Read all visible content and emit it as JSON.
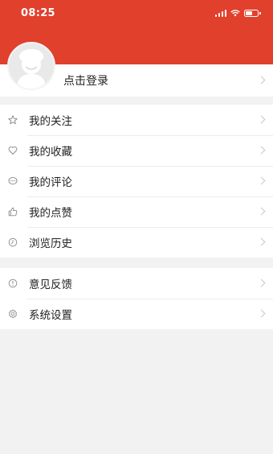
{
  "status_bar": {
    "time": "08:25",
    "battery_level": 0.55
  },
  "profile": {
    "login_label": "点击登录"
  },
  "menu_group_1": [
    {
      "icon": "star-icon",
      "label": "我的关注"
    },
    {
      "icon": "heart-icon",
      "label": "我的收藏"
    },
    {
      "icon": "comment-icon",
      "label": "我的评论"
    },
    {
      "icon": "thumbs-up-icon",
      "label": "我的点赞"
    },
    {
      "icon": "history-icon",
      "label": "浏览历史"
    }
  ],
  "menu_group_2": [
    {
      "icon": "feedback-icon",
      "label": "意见反馈"
    },
    {
      "icon": "settings-icon",
      "label": "系统设置"
    }
  ],
  "colors": {
    "header": "#e0402c",
    "background": "#f2f2f2"
  }
}
